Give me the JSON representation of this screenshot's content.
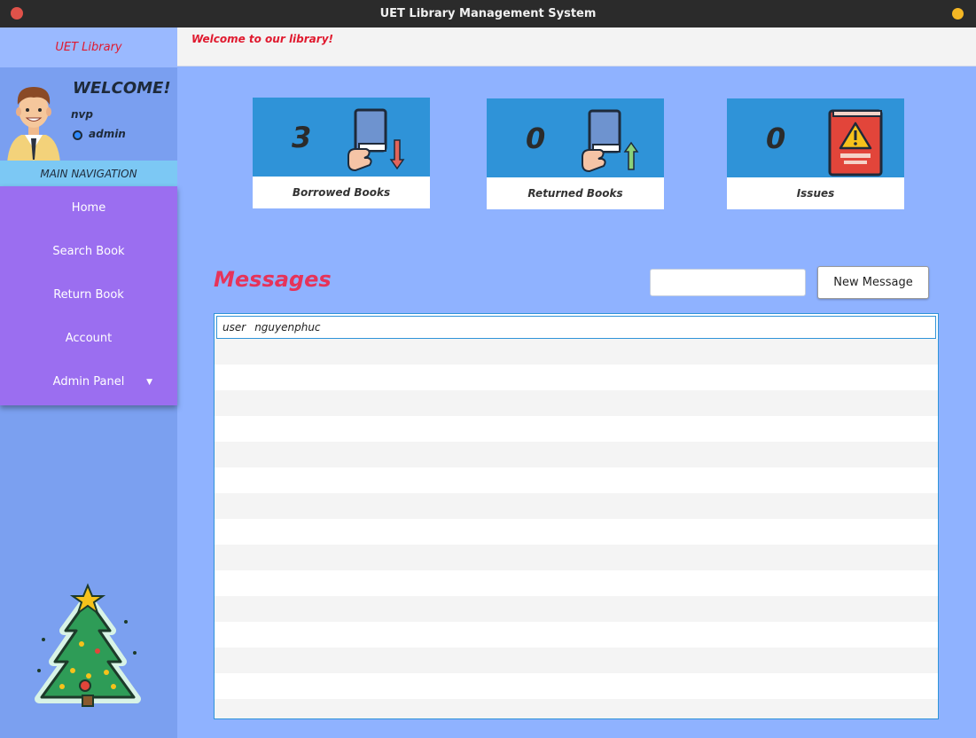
{
  "window": {
    "title": "UET Library Management System"
  },
  "sidebar": {
    "logo": "UET Library",
    "welcome": "WELCOME!",
    "username": "nvp",
    "role": "admin",
    "nav_header": "MAIN NAVIGATION",
    "items": [
      {
        "label": "Home"
      },
      {
        "label": "Search Book"
      },
      {
        "label": "Return Book"
      },
      {
        "label": "Account"
      },
      {
        "label": "Admin Panel"
      }
    ]
  },
  "topbar": {
    "text": "Welcome to our library!"
  },
  "cards": [
    {
      "value": "3",
      "label": "Borrowed Books",
      "icon": "borrow-book-icon"
    },
    {
      "value": "0",
      "label": "Returned Books",
      "icon": "return-book-icon"
    },
    {
      "value": "0",
      "label": "Issues",
      "icon": "warning-book-icon"
    }
  ],
  "messages": {
    "title": "Messages",
    "input_value": "",
    "new_button": "New Message",
    "rows": [
      {
        "user": "user",
        "name": "nguyenphuc"
      }
    ]
  },
  "colors": {
    "background": "#8fb2ff",
    "sidebar_nav": "#9b6ef0",
    "card_accent": "#2f93d8",
    "title_red": "#e0192e",
    "messages_pink": "#e6335a"
  }
}
